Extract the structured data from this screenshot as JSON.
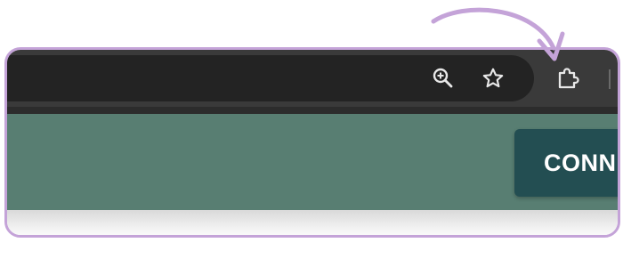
{
  "toolbar": {
    "icons": {
      "zoom": "zoom-in-icon",
      "bookmark": "star-icon",
      "extensions": "puzzle-icon"
    }
  },
  "page": {
    "connect_label": "CONN"
  },
  "colors": {
    "highlight": "#c4a3d8",
    "toolbar": "#3a3a3a",
    "omnibox": "#232323",
    "page_band": "#587e72",
    "button": "#234e52",
    "button_text": "#ffffff"
  }
}
